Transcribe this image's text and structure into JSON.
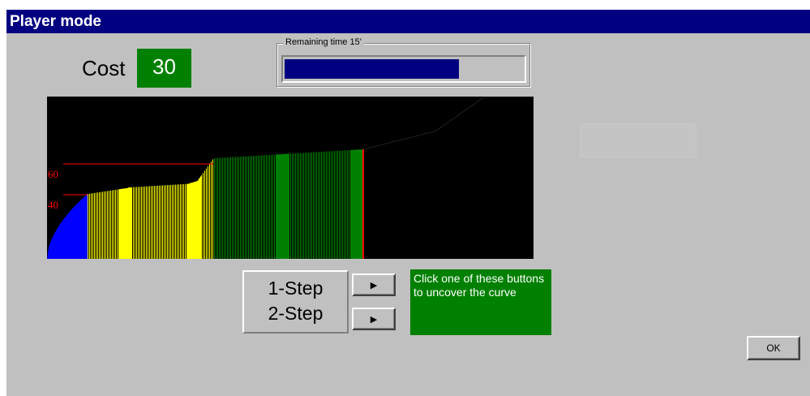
{
  "window": {
    "title": "Player mode"
  },
  "cost": {
    "label": "Cost",
    "value": "30",
    "box_color": "#008000"
  },
  "remaining_time": {
    "label": "Remaining time 15'",
    "fraction": 0.73,
    "bar_color": "#000080"
  },
  "chart_data": {
    "type": "bar",
    "y_ticks": [
      "40",
      "60"
    ],
    "threshold_color": "#ff0000",
    "uncovered_until_fraction": 0.65,
    "colors": {
      "blue": "#0000ff",
      "yellow": "#ffff00",
      "green": "#008000",
      "curve": "#000000"
    }
  },
  "steps": {
    "one_step": "1-Step",
    "two_step": "2-Step",
    "arrow_icon": "triangle-right-icon"
  },
  "hint": {
    "text": "Click one of these buttons to uncover the curve",
    "color": "#008000"
  },
  "ok_button": {
    "label": "OK"
  }
}
